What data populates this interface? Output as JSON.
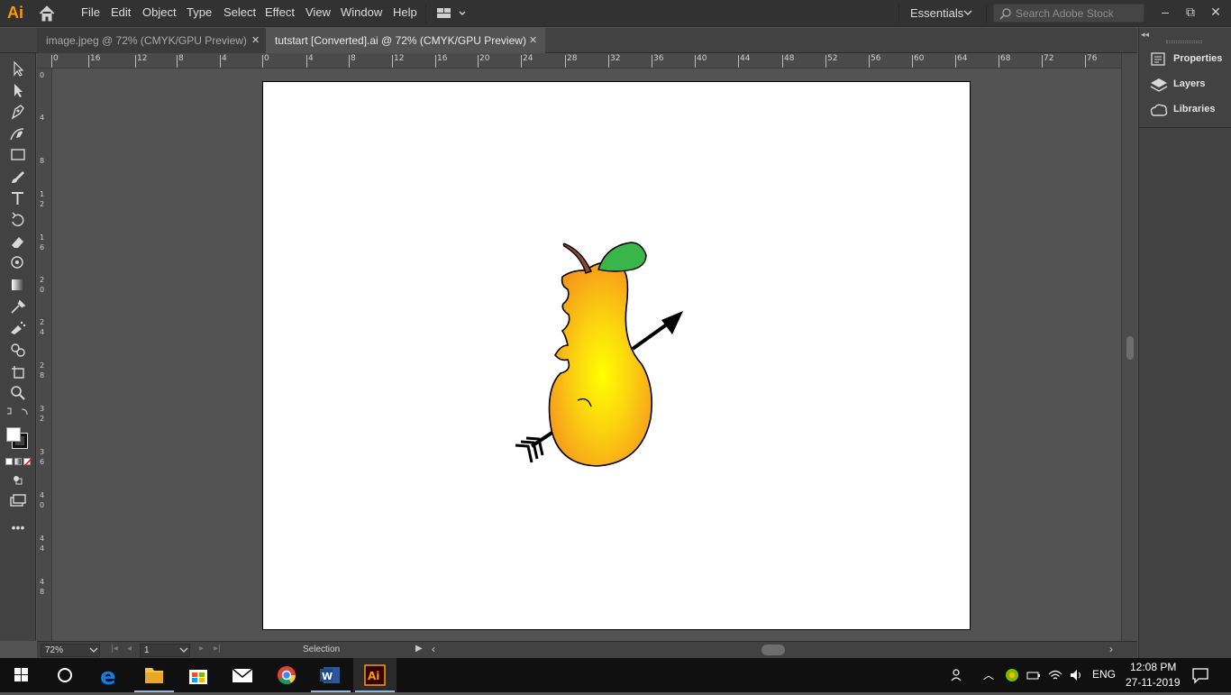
{
  "app": {
    "logo_text": "Ai"
  },
  "menu": {
    "items": [
      "File",
      "Edit",
      "Object",
      "Type",
      "Select",
      "Effect",
      "View",
      "Window",
      "Help"
    ]
  },
  "workspace": {
    "label": "Essentials"
  },
  "search": {
    "placeholder": "Search Adobe Stock"
  },
  "tabs": [
    {
      "label": "image.jpeg @ 72% (CMYK/GPU Preview)",
      "close": "✕",
      "active": false
    },
    {
      "label": "tutstart [Converted].ai @ 72% (CMYK/GPU Preview)",
      "close": "✕",
      "active": true
    }
  ],
  "ruler_top": [
    "0",
    "16",
    "12",
    "8",
    "4",
    "0",
    "4",
    "8",
    "12",
    "16",
    "20",
    "24",
    "28",
    "32",
    "36",
    "40",
    "44",
    "48",
    "52",
    "56",
    "60",
    "64",
    "68",
    "72",
    "76"
  ],
  "ruler_left": [
    "0",
    "4",
    "8",
    "1 2",
    "1 6",
    "2 0",
    "2 4",
    "2 8",
    "3 2",
    "3 6",
    "4 0",
    "4 4",
    "4 8"
  ],
  "status": {
    "zoom": "72%",
    "page": "1",
    "tool": "Selection"
  },
  "panels": [
    {
      "label": "Properties",
      "icon": "properties-icon"
    },
    {
      "label": "Layers",
      "icon": "layers-icon"
    },
    {
      "label": "Libraries",
      "icon": "libraries-icon"
    }
  ],
  "taskbar": {
    "language": "ENG",
    "time": "12:08 PM",
    "date": "27-11-2019"
  },
  "colors": {
    "accent": "#ff9a00",
    "pear_light": "#ffff00",
    "pear_dark": "#f7941d",
    "leaf": "#39b54a",
    "stem": "#8b4a2b"
  }
}
